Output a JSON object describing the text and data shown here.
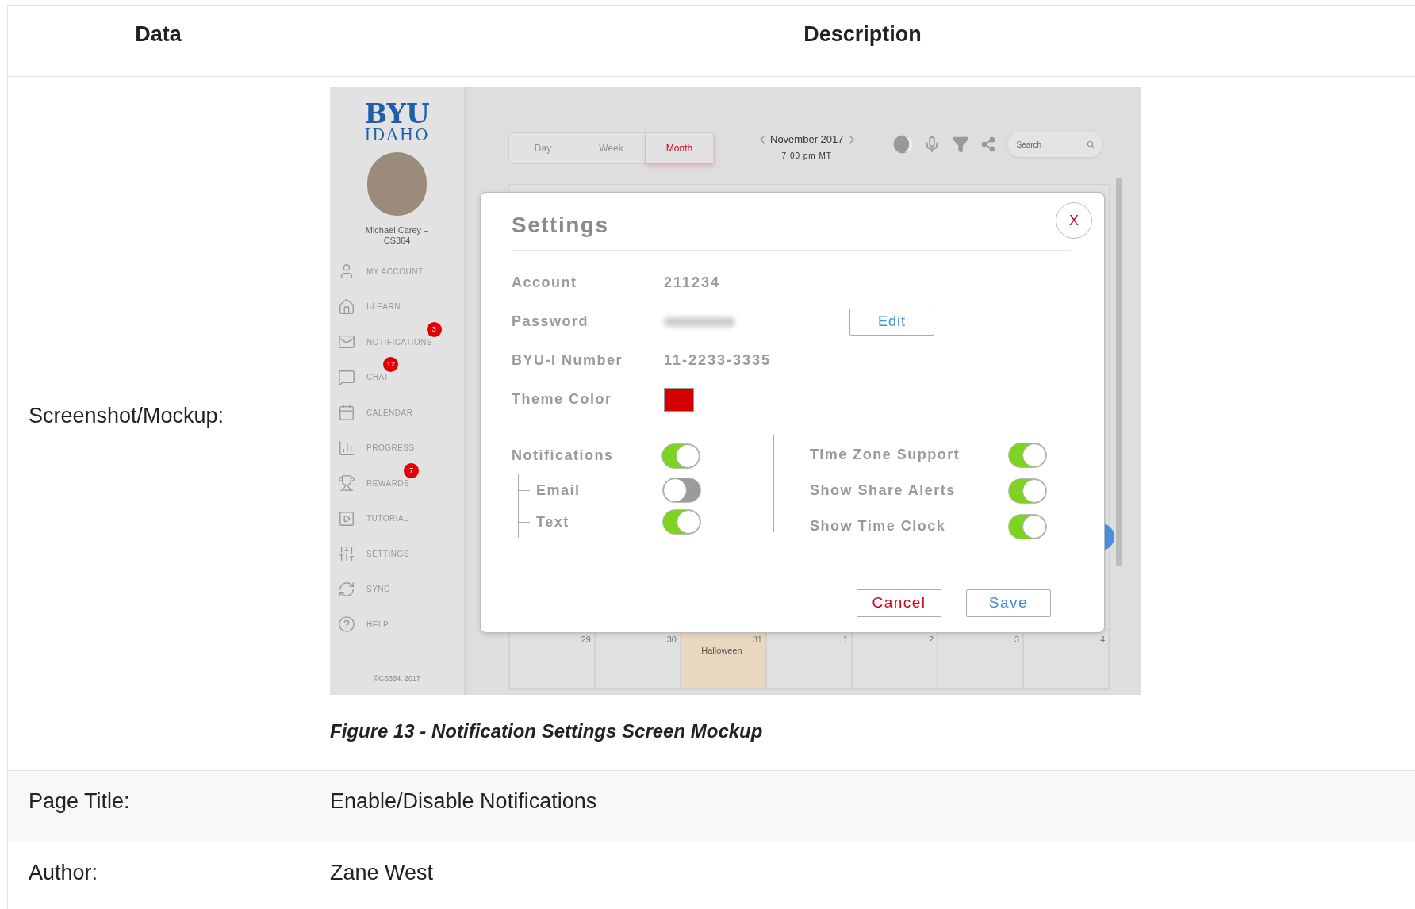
{
  "table": {
    "columns": [
      "Data",
      "Description"
    ],
    "rows": [
      {
        "kind": "mockup",
        "label": "Screenshot/Mockup:"
      },
      {
        "kind": "text",
        "label": "Page Title:",
        "value": "Enable/Disable Notifications"
      },
      {
        "kind": "text",
        "label": "Author:",
        "value": "Zane West"
      }
    ]
  },
  "mockup": {
    "sidebar": {
      "logo_top": "BYU",
      "logo_bottom": "IDAHO",
      "user_name": "Michael Carey – CS364",
      "items": [
        {
          "label": "MY ACCOUNT"
        },
        {
          "label": "I-LEARN"
        },
        {
          "label": "NOTIFICATIONS",
          "badge": "3"
        },
        {
          "label": "CHAT",
          "badge": "12"
        },
        {
          "label": "CALENDAR"
        },
        {
          "label": "PROGRESS"
        },
        {
          "label": "REWARDS",
          "badge": "7"
        },
        {
          "label": "TUTORIAL"
        },
        {
          "label": "SETTINGS"
        },
        {
          "label": "SYNC"
        },
        {
          "label": "HELP"
        }
      ],
      "footer": "©CS364, 2017"
    },
    "views": [
      {
        "label": "Day",
        "selected": false
      },
      {
        "label": "Week",
        "selected": false
      },
      {
        "label": "Month",
        "selected": true
      }
    ],
    "month": "November 2017",
    "time": "7:00 pm MT",
    "search": {
      "placeholder": "Search"
    },
    "days": [
      {
        "date": "29"
      },
      {
        "date": "30"
      },
      {
        "date": "31",
        "event": "Halloween"
      },
      {
        "date": "1"
      },
      {
        "date": "2"
      },
      {
        "date": "3"
      },
      {
        "date": "4"
      }
    ],
    "dialog": {
      "title": "Settings",
      "close": "X",
      "fields": [
        {
          "kind": "text",
          "label": "Account",
          "value": "211234"
        },
        {
          "kind": "secret",
          "label": "Password",
          "button": "Edit"
        },
        {
          "kind": "text",
          "label": "BYU-I Number",
          "value": "11-2233-3335"
        },
        {
          "kind": "color",
          "label": "Theme Color",
          "color": "#d40000"
        }
      ],
      "toggles_left": [
        {
          "label": "Notifications",
          "on": true,
          "children": [
            {
              "label": "Email",
              "on": false
            },
            {
              "label": "Text",
              "on": true
            }
          ]
        }
      ],
      "toggles_right": [
        {
          "label": "Time Zone Support",
          "on": true
        },
        {
          "label": "Show Share Alerts",
          "on": true
        },
        {
          "label": "Show Time Clock",
          "on": true
        }
      ],
      "cancel": "Cancel",
      "save": "Save"
    }
  },
  "caption": "Figure 13 - Notification Settings Screen Mockup"
}
